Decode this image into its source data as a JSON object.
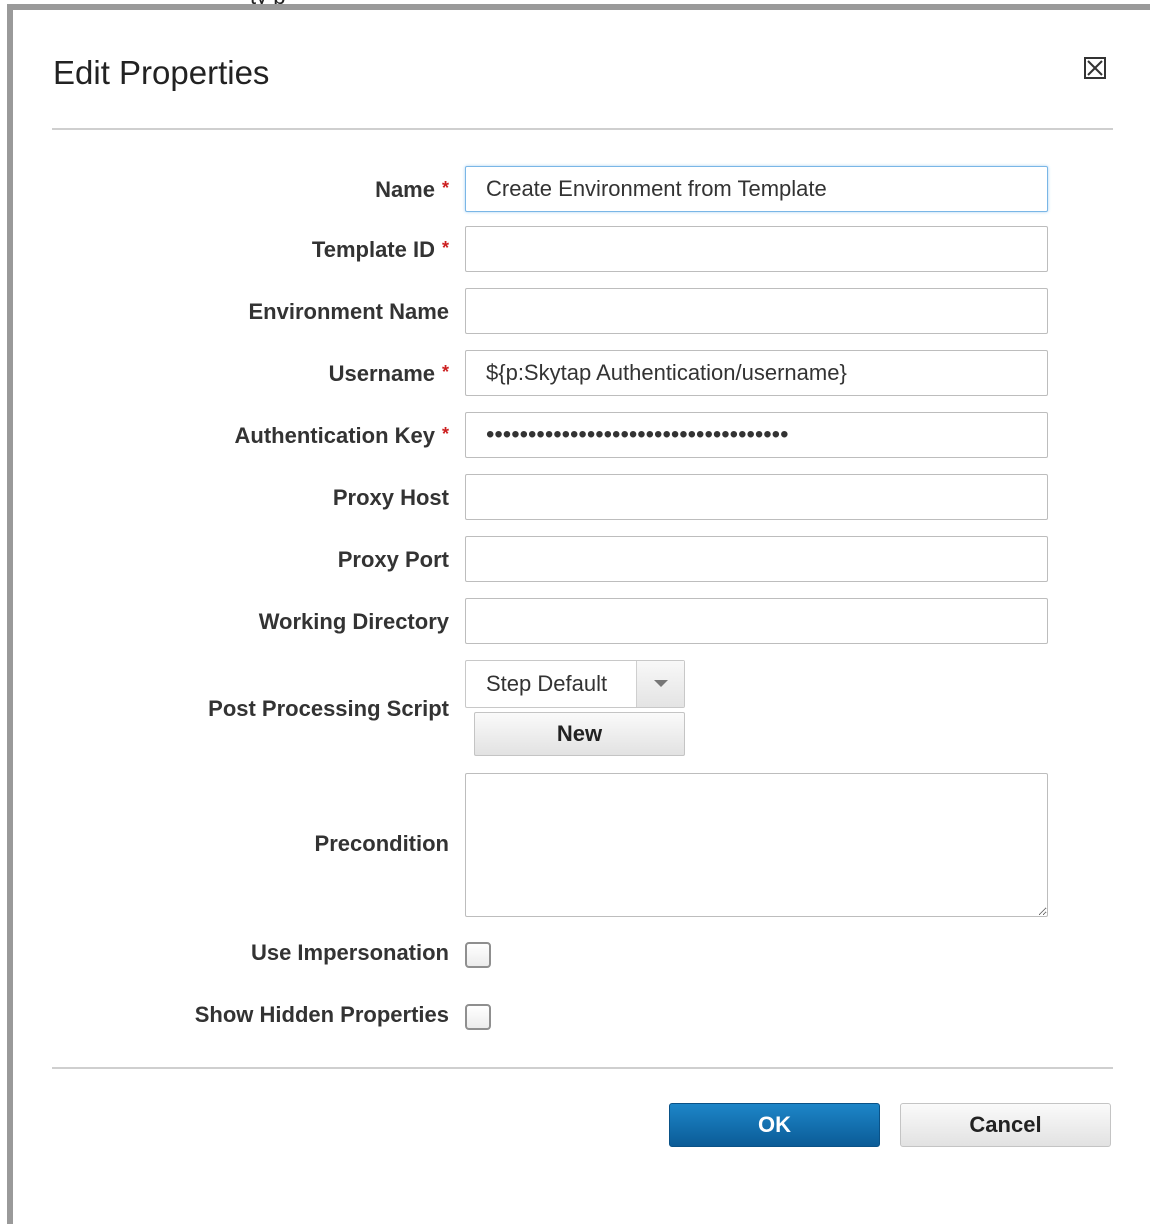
{
  "page_header_partial": "ty p",
  "dialog": {
    "title": "Edit Properties",
    "close_icon": "close-box-icon"
  },
  "required_marker": "*",
  "fields": {
    "name": {
      "label": "Name",
      "value": "Create Environment from Template",
      "required": true
    },
    "template_id": {
      "label": "Template ID",
      "value": "",
      "required": true
    },
    "environment_name": {
      "label": "Environment Name",
      "value": "",
      "required": false
    },
    "username": {
      "label": "Username",
      "value": "${p:Skytap Authentication/username}",
      "required": true
    },
    "authentication_key": {
      "label": "Authentication Key",
      "value": "••••••••••••••••••••••••••••••••••••",
      "required": true
    },
    "proxy_host": {
      "label": "Proxy Host",
      "value": "",
      "required": false
    },
    "proxy_port": {
      "label": "Proxy Port",
      "value": "",
      "required": false
    },
    "working_directory": {
      "label": "Working Directory",
      "value": "",
      "required": false
    },
    "post_processing_script": {
      "label": "Post Processing Script",
      "selected": "Step Default",
      "new_button": "New"
    },
    "precondition": {
      "label": "Precondition",
      "value": ""
    },
    "use_impersonation": {
      "label": "Use Impersonation",
      "checked": false
    },
    "show_hidden_properties": {
      "label": "Show Hidden Properties",
      "checked": false
    }
  },
  "footer": {
    "ok_label": "OK",
    "cancel_label": "Cancel"
  },
  "colors": {
    "primary_button": "#1172b3",
    "required_asterisk": "#cc1f1f",
    "focus_border": "#7ab6e6"
  }
}
